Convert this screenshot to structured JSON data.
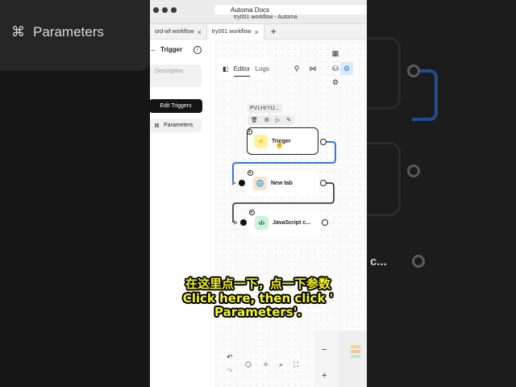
{
  "window": {
    "title": "try001 workflow - Automa",
    "ghost_title": "Automa Docs"
  },
  "tabs": [
    {
      "label": "ord-wf workflow",
      "close": "×"
    },
    {
      "label": "try001 workflow",
      "close": "×"
    }
  ],
  "tab_add": "+",
  "sidebar": {
    "back_label": "Trigger",
    "description_placeholder": "Description",
    "edit_triggers_label": "Edit Triggers",
    "parameters_label": "Parameters"
  },
  "toolbar": {
    "editor_label": "Editor",
    "logs_label": "Logs"
  },
  "node_id": "PVLHrYIJ...",
  "nodes": [
    {
      "label": "Trigger",
      "icon": "lightning-icon",
      "icon_color": "#fff3a0"
    },
    {
      "label": "New tab",
      "icon": "globe-icon",
      "icon_color": "#ffe2c8"
    },
    {
      "label": "JavaScript c...",
      "icon": "code-icon",
      "icon_color": "#c9f5d4"
    }
  ],
  "zoom": {
    "minus": "−",
    "plus": "+"
  },
  "background": {
    "parameters_label": "Parameters",
    "ghost_text": "c..."
  },
  "caption": {
    "chinese": "在这里点一下，点一下参数",
    "english_line1": "Click here, then click '",
    "english_line2": "Parameters'."
  },
  "colors": {
    "connector": "#3a78d8",
    "caption_text": "#f5f520",
    "primary_button": "#141414",
    "active_tool": "#d9ebff"
  }
}
